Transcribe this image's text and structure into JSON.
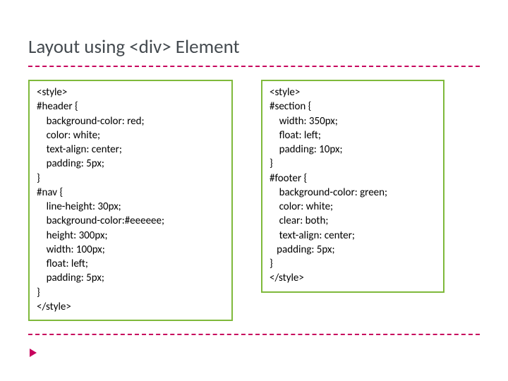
{
  "title": "Layout using <div> Element",
  "code_left": "<style>\n#header {\n    background-color: red;\n    color: white;\n    text-align: center;\n    padding: 5px;\n}\n#nav {\n    line-height: 30px;\n    background-color:#eeeeee;\n    height: 300px;\n    width: 100px;\n    float: left;\n    padding: 5px;\n}\n</style>",
  "code_right": "<style>\n#section {\n    width: 350px;\n    float: left;\n    padding: 10px;\n}\n#footer {\n    background-color: green;\n    color: white;\n    clear: both;\n    text-align: center;\n   padding: 5px;\n}\n</style>"
}
